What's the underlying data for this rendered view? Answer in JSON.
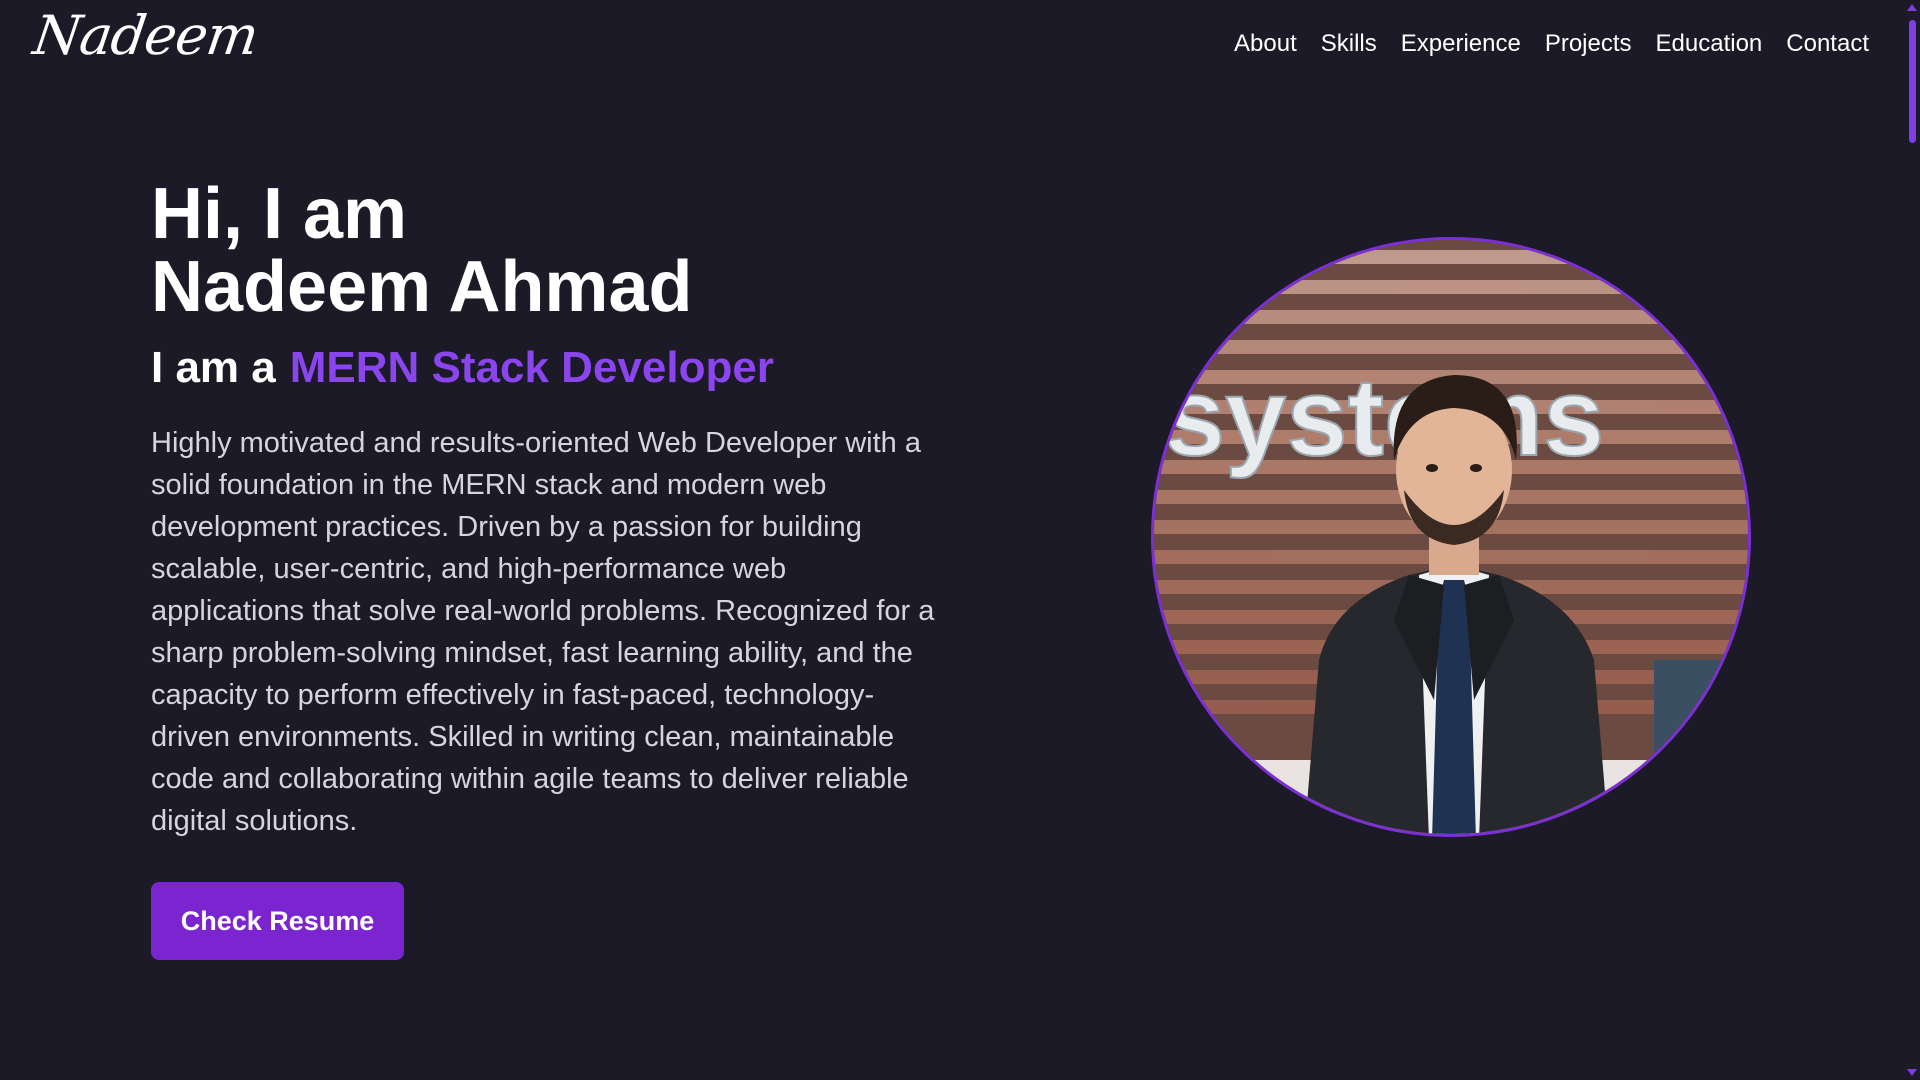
{
  "header": {
    "logo": "Nadeem",
    "nav": [
      "About",
      "Skills",
      "Experience",
      "Projects",
      "Education",
      "Contact"
    ]
  },
  "hero": {
    "greeting": "Hi, I am",
    "name": "Nadeem Ahmad",
    "role_prefix": "I am a",
    "role_value": "MERN Stack Developer",
    "bio": "Highly motivated and results-oriented Web Developer with a solid foundation in the MERN stack and modern web development practices. Driven by a passion for building scalable, user-centric, and high-performance web applications that solve real-world problems. Recognized for a sharp problem-solving mindset, fast learning ability, and the capacity to perform effectively in fast-paced, technology-driven environments. Skilled in writing clean, maintainable code and collaborating within agile teams to deliver reliable digital solutions.",
    "button_label": "Check Resume"
  },
  "portrait": {
    "sign_text": "systems"
  },
  "colors": {
    "background": "#1b1a26",
    "accent": "#8b45ef",
    "button": "#7a25cf"
  }
}
